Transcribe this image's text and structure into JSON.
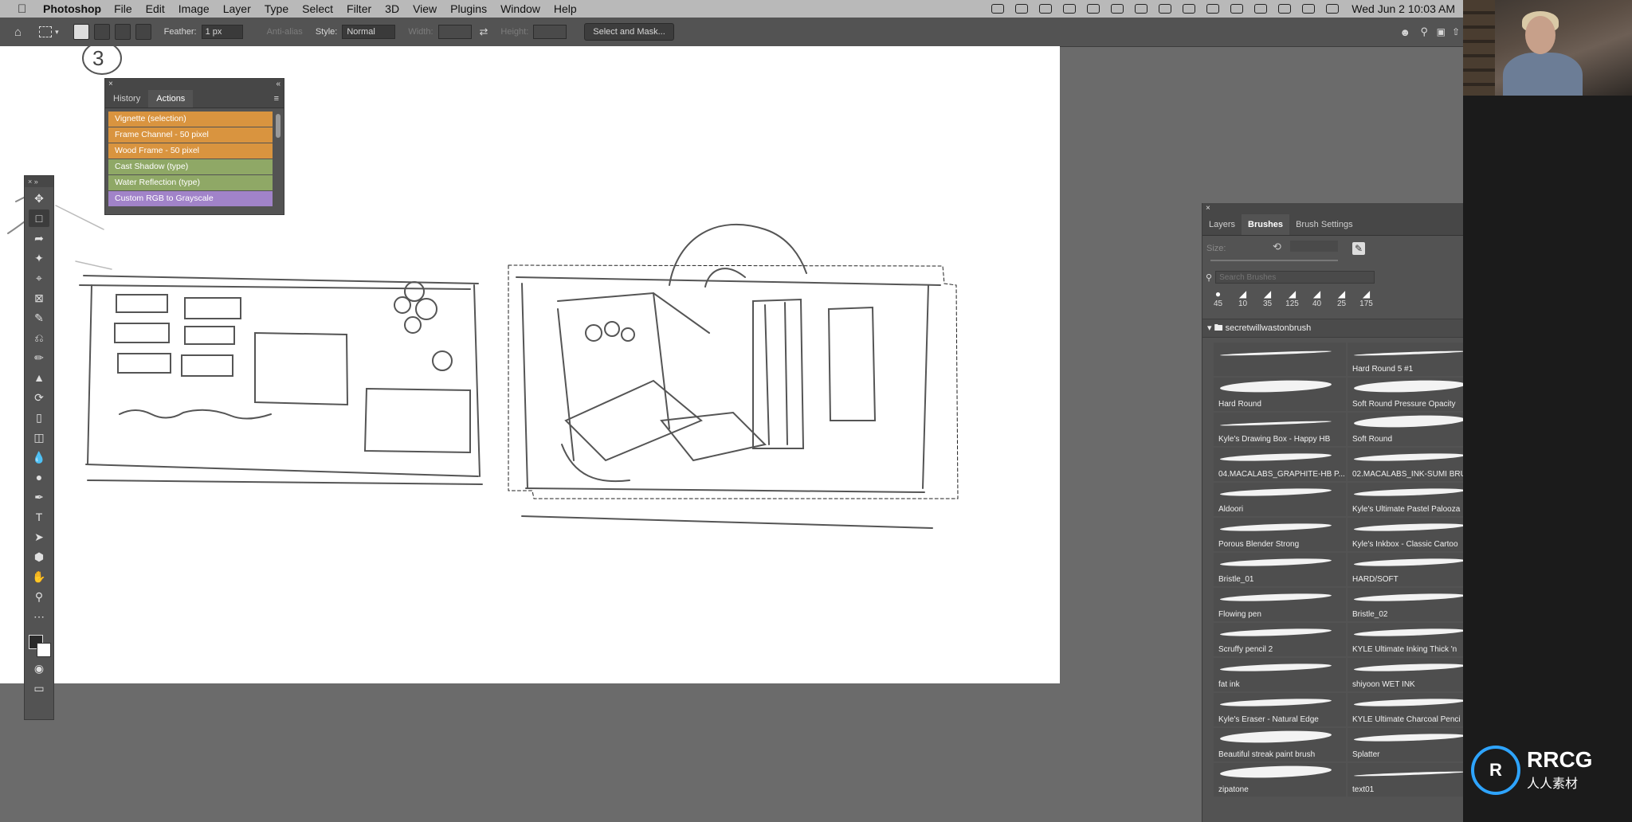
{
  "menubar": {
    "app_name": "Photoshop",
    "items": [
      "File",
      "Edit",
      "Image",
      "Layer",
      "Type",
      "Select",
      "Filter",
      "3D",
      "View",
      "Plugins",
      "Window",
      "Help"
    ],
    "clock": "Wed Jun 2  10:03 AM"
  },
  "options_bar": {
    "feather_label": "Feather:",
    "feather_value": "1 px",
    "antialias_label": "Anti-alias",
    "style_label": "Style:",
    "style_value": "Normal",
    "width_label": "Width:",
    "height_label": "Height:",
    "select_mask_label": "Select and Mask..."
  },
  "actions_panel": {
    "tabs": [
      "History",
      "Actions"
    ],
    "active_tab": "Actions",
    "actions": [
      {
        "label": "Vignette (selection)",
        "color": "#d9943f"
      },
      {
        "label": "Frame Channel - 50 pixel",
        "color": "#d9943f"
      },
      {
        "label": "Wood Frame - 50 pixel",
        "color": "#d9943f"
      },
      {
        "label": "Cast Shadow (type)",
        "color": "#8fa866"
      },
      {
        "label": "Water Reflection (type)",
        "color": "#8fa866"
      },
      {
        "label": "Custom RGB to Grayscale",
        "color": "#a183c9"
      }
    ]
  },
  "brushes_panel": {
    "tabs": [
      "Layers",
      "Brushes",
      "Brush Settings"
    ],
    "active_tab": "Brushes",
    "size_label": "Size:",
    "search_placeholder": "Search Brushes",
    "recent_sizes": [
      "45",
      "10",
      "35",
      "125",
      "40",
      "25",
      "175"
    ],
    "folder_name": "secretwillwastonbrush",
    "brushes": [
      {
        "name": "",
        "style": "thin"
      },
      {
        "name": "Hard Round 5 #1",
        "style": "thin"
      },
      {
        "name": "Hard Round",
        "style": "fat"
      },
      {
        "name": "Soft Round Pressure Opacity",
        "style": "fat"
      },
      {
        "name": "Kyle's Drawing Box - Happy HB",
        "style": "thin"
      },
      {
        "name": "Soft Round",
        "style": "fat"
      },
      {
        "name": "04.MACALABS_GRAPHITE-HB P...",
        "style": "normal"
      },
      {
        "name": "02.MACALABS_INK-SUMI BRU",
        "style": "normal"
      },
      {
        "name": "Aldoori",
        "style": "normal"
      },
      {
        "name": "Kyle's Ultimate Pastel Palooza",
        "style": "normal"
      },
      {
        "name": "Porous Blender Strong",
        "style": "normal"
      },
      {
        "name": "Kyle's Inkbox - Classic Cartoo",
        "style": "normal"
      },
      {
        "name": "Bristle_01",
        "style": "normal"
      },
      {
        "name": "HARD/SOFT",
        "style": "normal"
      },
      {
        "name": "Flowing pen",
        "style": "normal"
      },
      {
        "name": "Bristle_02",
        "style": "normal"
      },
      {
        "name": "Scruffy pencil 2",
        "style": "normal"
      },
      {
        "name": "KYLE Ultimate Inking Thick 'n",
        "style": "normal"
      },
      {
        "name": "fat ink",
        "style": "normal"
      },
      {
        "name": "shiyoon WET INK",
        "style": "normal"
      },
      {
        "name": "Kyle's Eraser - Natural Edge",
        "style": "normal"
      },
      {
        "name": "KYLE Ultimate Charcoal Penci",
        "style": "normal"
      },
      {
        "name": "Beautiful streak paint brush",
        "style": "fat"
      },
      {
        "name": "Splatter",
        "style": "normal"
      },
      {
        "name": "zipatone",
        "style": "fat"
      },
      {
        "name": "text01",
        "style": "thin"
      }
    ]
  },
  "canvas": {
    "annotation_number": "3"
  },
  "watermark": {
    "logo_text": "RRCG",
    "logo_sub": "人人素材"
  }
}
